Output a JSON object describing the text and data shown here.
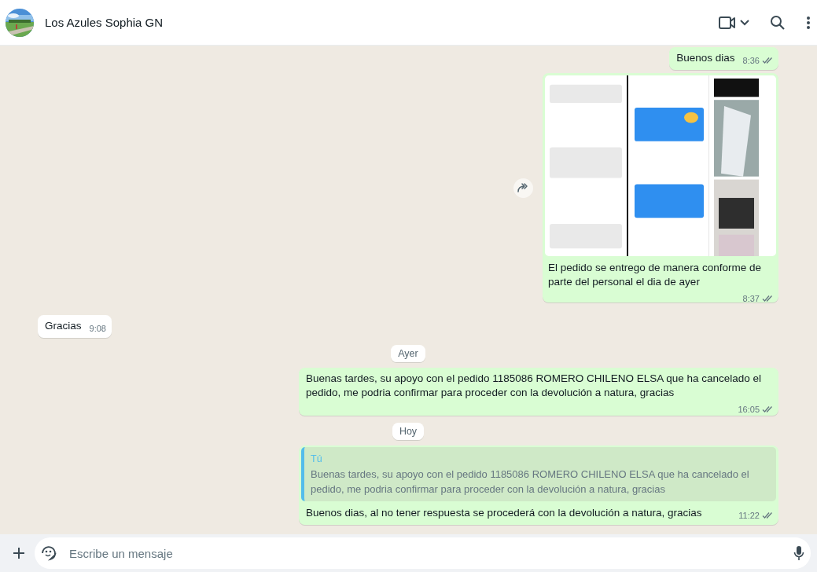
{
  "chat": {
    "title": "Los Azules Sophia GN"
  },
  "messages": [
    {
      "kind": "text",
      "outgoing": true,
      "text": "Buenos dias",
      "time": "8:36",
      "read": false
    },
    {
      "outgoing": true,
      "caption": "El pedido se entrego de manera conforme de parte del personal el dia de ayer",
      "time": "8:37",
      "read": false
    },
    {
      "kind": "text",
      "outgoing": false,
      "text": "Gracias",
      "time": "9:08"
    },
    {
      "kind": "date",
      "text": "Ayer"
    },
    {
      "kind": "text",
      "outgoing": true,
      "text": "Buenas tardes, su apoyo con el pedido 1185086 ROMERO CHILENO ELSA que ha cancelado el pedido, me podria confirmar para proceder con la devolución a natura, gracias",
      "time": "16:05",
      "read": false
    },
    {
      "kind": "date",
      "text": "Hoy"
    },
    {
      "kind": "reply",
      "outgoing": true,
      "quote": {
        "author": "Tú",
        "text": "Buenas tardes, su apoyo con el pedido 1185086 ROMERO CHILENO ELSA que ha cancelado el pedido, me podria confirmar para proceder con la devolución a natura, gracias"
      },
      "text": "Buenos dias, al no tener respuesta se procederá con la devolución a natura, gracias",
      "time": "11:22",
      "read": false
    }
  ],
  "composer": {
    "placeholder": "Escribe un mensaje"
  }
}
